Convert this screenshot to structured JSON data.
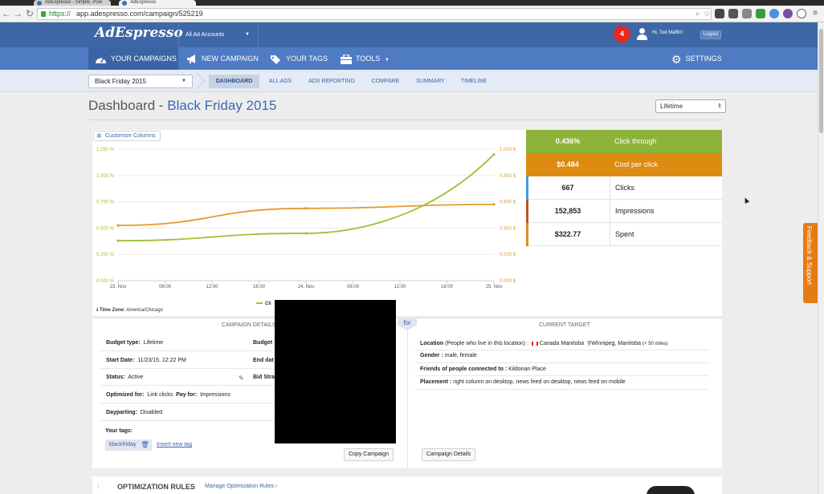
{
  "browser": {
    "tabs": [
      {
        "title": "AdEspresso - Simple, Pow"
      },
      {
        "title": "AdEspresso"
      }
    ],
    "url_scheme": "https://",
    "url_rest": "app.adespresso.com/campaign/525219"
  },
  "header": {
    "logo": "AdEspresso",
    "account_selector": "All Ad Accounts",
    "notification_count": "4",
    "greeting": "Hi, Tod Maffin!",
    "logout": "Logout"
  },
  "main_nav": {
    "your_campaigns": "YOUR CAMPAIGNS",
    "new_campaign": "NEW CAMPAIGN",
    "your_tags": "YOUR TAGS",
    "tools": "TOOLS",
    "settings": "SETTINGS"
  },
  "sub_nav": {
    "campaign_select": "Black Friday 2015",
    "tabs": [
      "DASHBOARD",
      "ALL ADS",
      "ADS REPORTING",
      "COMPARE",
      "SUMMARY",
      "TIMELINE"
    ]
  },
  "page": {
    "title": "Dashboard -",
    "campaign_name": "Black Friday 2015",
    "period": "Lifetime"
  },
  "chart_panel": {
    "customize_columns": "Customize Columns",
    "timezone_label": "Time Zone:",
    "timezone_value": "America/Chicago"
  },
  "chart_data": {
    "type": "line",
    "x_ticks": [
      "23. Nov",
      "06:00",
      "12:00",
      "18:00",
      "24. Nov",
      "06:00",
      "12:00",
      "18:00",
      "25. Nov"
    ],
    "y_left_ticks": [
      "0.000 %",
      "0.250 %",
      "0.500 %",
      "0.750 %",
      "1.000 %",
      "1.250 %"
    ],
    "y_right_ticks": [
      "0.000 $",
      "0.200 $",
      "0.400 $",
      "0.600 $",
      "0.800 $",
      "1.000 $"
    ],
    "ylim_left": [
      0,
      1.25
    ],
    "ylim_right": [
      0,
      1.0
    ],
    "x_positions_hours": [
      0,
      24,
      48
    ],
    "series": [
      {
        "name": "Cli",
        "axis": "left",
        "color": "#9cc23a",
        "x_hours": [
          0,
          24,
          48
        ],
        "values": [
          0.38,
          0.45,
          1.2
        ]
      },
      {
        "name": "",
        "axis": "right",
        "color": "#e49a2a",
        "x_hours": [
          0,
          24,
          48
        ],
        "values": [
          0.42,
          0.55,
          0.58
        ]
      }
    ],
    "legend_visible": "Cli",
    "grid": true
  },
  "metrics": [
    {
      "value": "0.436%",
      "label": "Click through",
      "style": "green"
    },
    {
      "value": "$0.484",
      "label": "Cost per click",
      "style": "orange"
    },
    {
      "value": "667",
      "label": "Clicks",
      "style": "white",
      "accent": "#3aa0e0"
    },
    {
      "value": "152,853",
      "label": "Impressions",
      "style": "white",
      "accent": "#c0502a"
    },
    {
      "value": "$322.77",
      "label": "Spent",
      "style": "white",
      "accent": "#e08a20"
    }
  ],
  "details": {
    "campaign_header": "CAMPAIGN DETAILS",
    "target_header": "CURRENT TARGET",
    "for_label": "for",
    "budget_type_label": "Budget type:",
    "budget_type_value": "Lifetime",
    "start_date_label": "Start Date:",
    "start_date_value": "11/23/15, 12:22 PM",
    "status_label": "Status:",
    "status_value": "Active",
    "optimized_label": "Optimized for:",
    "optimized_value": "Link clicks",
    "pay_label": "Pay for:",
    "pay_value": "Impressions",
    "dayparting_label": "Dayparting:",
    "dayparting_value": "Disabled",
    "budget_label": "Budget",
    "end_label": "End dat",
    "bid_label": "Bid Stra",
    "tags_label": "Your tags:",
    "tag": "blackfriday",
    "insert_tag": "Insert new tag",
    "copy_campaign": "Copy Campaign",
    "location_label": "Location",
    "location_note": "(People who live in this location) :",
    "location_value1": "Canada Manitoba",
    "location_value2": "Winnipeg, Manitoba",
    "location_radius": "(+ 50 miles)",
    "gender_label": "Gender :",
    "gender_value": "male, female",
    "friends_label": "Friends of people connected to :",
    "friends_value": "Kildonan Place",
    "placement_label": "Placement :",
    "placement_value": "right column on desktop, news feed on desktop, news feed on mobile",
    "campaign_details_btn": "Campaign Details"
  },
  "optimization": {
    "title": "OPTIMIZATION RULES",
    "manage": "Manage Optimization Rules ›"
  },
  "feedback": "Feedback & Support"
}
